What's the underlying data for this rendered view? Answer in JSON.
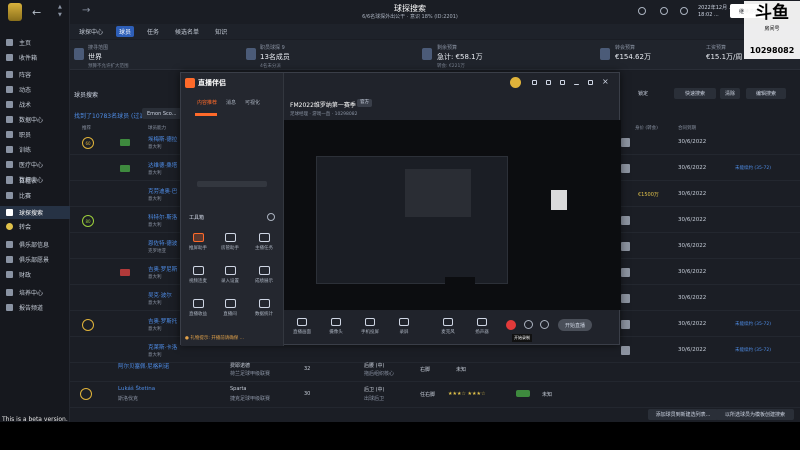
{
  "app": {
    "page_title": "球探搜索",
    "page_subtitle": "6/6名球探外出公干 · 意识 18% (ID:2201)",
    "date_line1": "2022年12月 ...",
    "date_line2": "18:02 ...",
    "continue_label": "继续游戏"
  },
  "tabs": [
    "球探中心",
    "球员",
    "任务",
    "候选名单",
    "知识"
  ],
  "sidebar": {
    "items": [
      {
        "label": "主页"
      },
      {
        "label": "收件箱"
      },
      {
        "label": "阵容"
      },
      {
        "label": "动态"
      },
      {
        "label": "战术"
      },
      {
        "label": "数据中心"
      },
      {
        "label": "职员"
      },
      {
        "label": "训练"
      },
      {
        "label": "医疗中心"
      },
      {
        "label": "数据中心"
      },
      {
        "label": "日程表"
      },
      {
        "label": "比赛"
      },
      {
        "label": "球探搜索"
      },
      {
        "label": "转会"
      },
      {
        "label": "俱乐部信息"
      },
      {
        "label": "俱乐部愿景"
      },
      {
        "label": "财政"
      },
      {
        "label": "培养中心"
      },
      {
        "label": "报告频道"
      }
    ]
  },
  "info": [
    {
      "label": "搜寻范围",
      "value": "世界",
      "sub": "预算不允许扩大范围"
    },
    {
      "label": "职员球探 9",
      "value": "13名成员",
      "sub": "4名未分派"
    },
    {
      "label": "剩余预算",
      "value": "急计: €58.1万",
      "sub": "转会: €221万"
    },
    {
      "label": "转会预算",
      "value": "€154.62万",
      "sub": ""
    },
    {
      "label": "工资预算",
      "value": "€15.1万/周",
      "sub": ""
    }
  ],
  "content": {
    "section_title": "球员搜索",
    "found_text": "找到了10783名球员 (过滤)",
    "filter_chip": "Emon Sco...",
    "controls": [
      "锁定",
      "快速搜索",
      "清除",
      "编辑搜索"
    ],
    "col_headers": [
      "推荐",
      "球员能力",
      "身价 (转会)",
      "合同到期"
    ]
  },
  "rows": [
    {
      "name": "埃梅斯·德拉",
      "nat": "意大利",
      "rec": "60",
      "date": "30/6/2022",
      "extra": "",
      "wage": ""
    },
    {
      "name": "达维德·桑塔",
      "nat": "意大利",
      "rec": "",
      "date": "30/6/2022",
      "extra": "未能续约 (35-72)",
      "wage": ""
    },
    {
      "name": "克劳迪奥·巴",
      "nat": "意大利",
      "rec": "",
      "date": "30/6/2022",
      "extra": "",
      "wage": "€1500万"
    },
    {
      "name": "科特尔·斯洛",
      "nat": "意大利",
      "rec": "80",
      "date": "30/6/2022",
      "extra": "",
      "wage": ""
    },
    {
      "name": "恩佐特·德波",
      "nat": "克罗地亚",
      "rec": "",
      "date": "30/6/2022",
      "extra": "",
      "wage": ""
    },
    {
      "name": "吉奥·罗尼斯",
      "nat": "意大利",
      "rec": "",
      "date": "30/6/2022",
      "extra": "",
      "wage": ""
    },
    {
      "name": "吴克·波尔",
      "nat": "意大利",
      "rec": "",
      "date": "30/6/2022",
      "extra": "",
      "wage": ""
    },
    {
      "name": "吉奥·罗斯托",
      "nat": "意大利",
      "rec": "",
      "date": "30/6/2022",
      "extra": "未能续约 (35-72)",
      "wage": ""
    },
    {
      "name": "克莱斯·卡洛",
      "nat": "意大利",
      "rec": "",
      "date": "30/6/2022",
      "extra": "未能续约 (35-72)",
      "wage": ""
    }
  ],
  "lower": {
    "row1_name": "阿尔贝塞佩·尼格利诺",
    "row1_club": "费耶诺德",
    "row1_club_sub": "荷兰足球甲级联赛",
    "row1_age": "32",
    "row1_pos": "后腰 (中)",
    "row1_pos_sub": "拖后组织核心",
    "row1_foot": "右脚",
    "row1_status": "未知",
    "row2_name": "Lukáš Štetina",
    "row2_nat": "斯洛伐克",
    "row2_club": "Sparta",
    "row2_club_sub": "捷克足球甲级联赛",
    "row2_age": "30",
    "row2_pos": "后卫 (中)",
    "row2_pos_sub": "出球后卫",
    "row2_foot": "任右脚",
    "row2_status": "未知",
    "footer_btn1": "添加球员到新建选列表...",
    "footer_btn2": "以所选球员为模板创建搜索"
  },
  "overlay": {
    "brand": "直播伴侣",
    "side_tabs": [
      "内容推荐",
      "消息",
      "可视化"
    ],
    "tool_title": "工具箱",
    "tools": [
      "推屏助手",
      "房管助手",
      "主播任务",
      "视频连麦",
      "录入设置",
      "成绩展示",
      "直播收益",
      "直播间",
      "数据统计"
    ],
    "tab_text": "FM2022维罗纳第一赛季",
    "tag": "官方",
    "sub_text": "足球经理 · 游戏一直 · 10298082",
    "notice": "● 礼物提示: 开播前请确保 ...",
    "controls": [
      "直播画面",
      "摄像头",
      "手机投屏",
      "录屏",
      "麦克风",
      "扬声器"
    ],
    "rec_tip": "开始录制",
    "start_label": "开始直播"
  },
  "beta": "This is a beta version.",
  "watermark": {
    "big": "斗鱼",
    "small": "房间号",
    "room": "10298082"
  },
  "colors": {
    "accent": "#2e5fb8",
    "link": "#4f8ee8",
    "gold": "#e0c14a",
    "record": "#e23a3a",
    "brand_orange": "#ff6a2a"
  }
}
